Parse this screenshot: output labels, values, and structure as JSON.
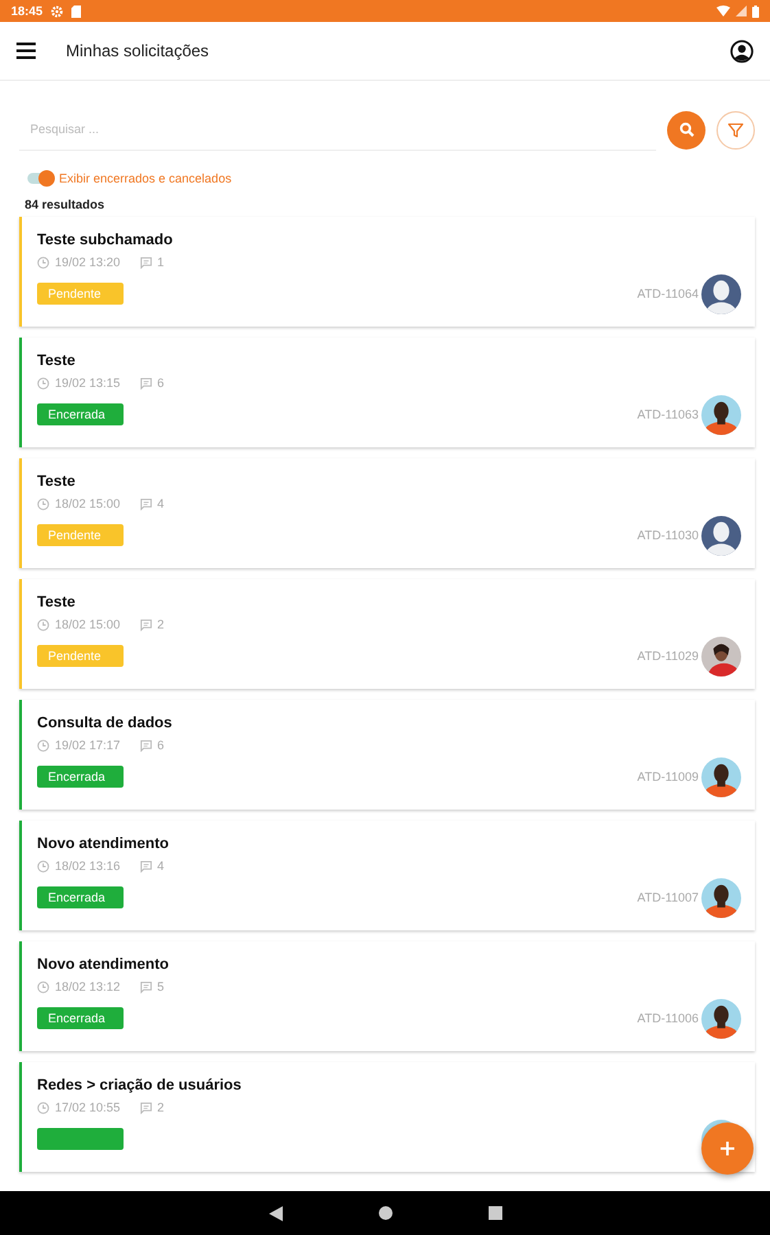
{
  "status_bar": {
    "time": "18:45"
  },
  "app_bar": {
    "title": "Minhas solicitações"
  },
  "search": {
    "placeholder": "Pesquisar ..."
  },
  "toggle": {
    "label": "Exibir encerrados e cancelados",
    "on": true
  },
  "result_count": "84 resultados",
  "requests": [
    {
      "title": "Teste subchamado",
      "date": "19/02 13:20",
      "comments": "1",
      "status": {
        "kind": "pending",
        "label": "Pendente"
      },
      "code": "ATD-11064"
    },
    {
      "title": "Teste",
      "date": "19/02 13:15",
      "comments": "6",
      "status": {
        "kind": "closed",
        "label": "Encerrada"
      },
      "code": "ATD-11063"
    },
    {
      "title": "Teste",
      "date": "18/02 15:00",
      "comments": "4",
      "status": {
        "kind": "pending",
        "label": "Pendente"
      },
      "code": "ATD-11030"
    },
    {
      "title": "Teste",
      "date": "18/02 15:00",
      "comments": "2",
      "status": {
        "kind": "pending",
        "label": "Pendente"
      },
      "code": "ATD-11029"
    },
    {
      "title": "Consulta de dados",
      "date": "19/02 17:17",
      "comments": "6",
      "status": {
        "kind": "closed",
        "label": "Encerrada"
      },
      "code": "ATD-11009"
    },
    {
      "title": "Novo atendimento",
      "date": "18/02 13:16",
      "comments": "4",
      "status": {
        "kind": "closed",
        "label": "Encerrada"
      },
      "code": "ATD-11007"
    },
    {
      "title": "Novo atendimento",
      "date": "18/02 13:12",
      "comments": "5",
      "status": {
        "kind": "closed",
        "label": "Encerrada"
      },
      "code": "ATD-11006"
    },
    {
      "title": "Redes > criação de usuários",
      "date": "17/02 10:55",
      "comments": "2",
      "status": {
        "kind": "closed"
      }
    }
  ]
}
